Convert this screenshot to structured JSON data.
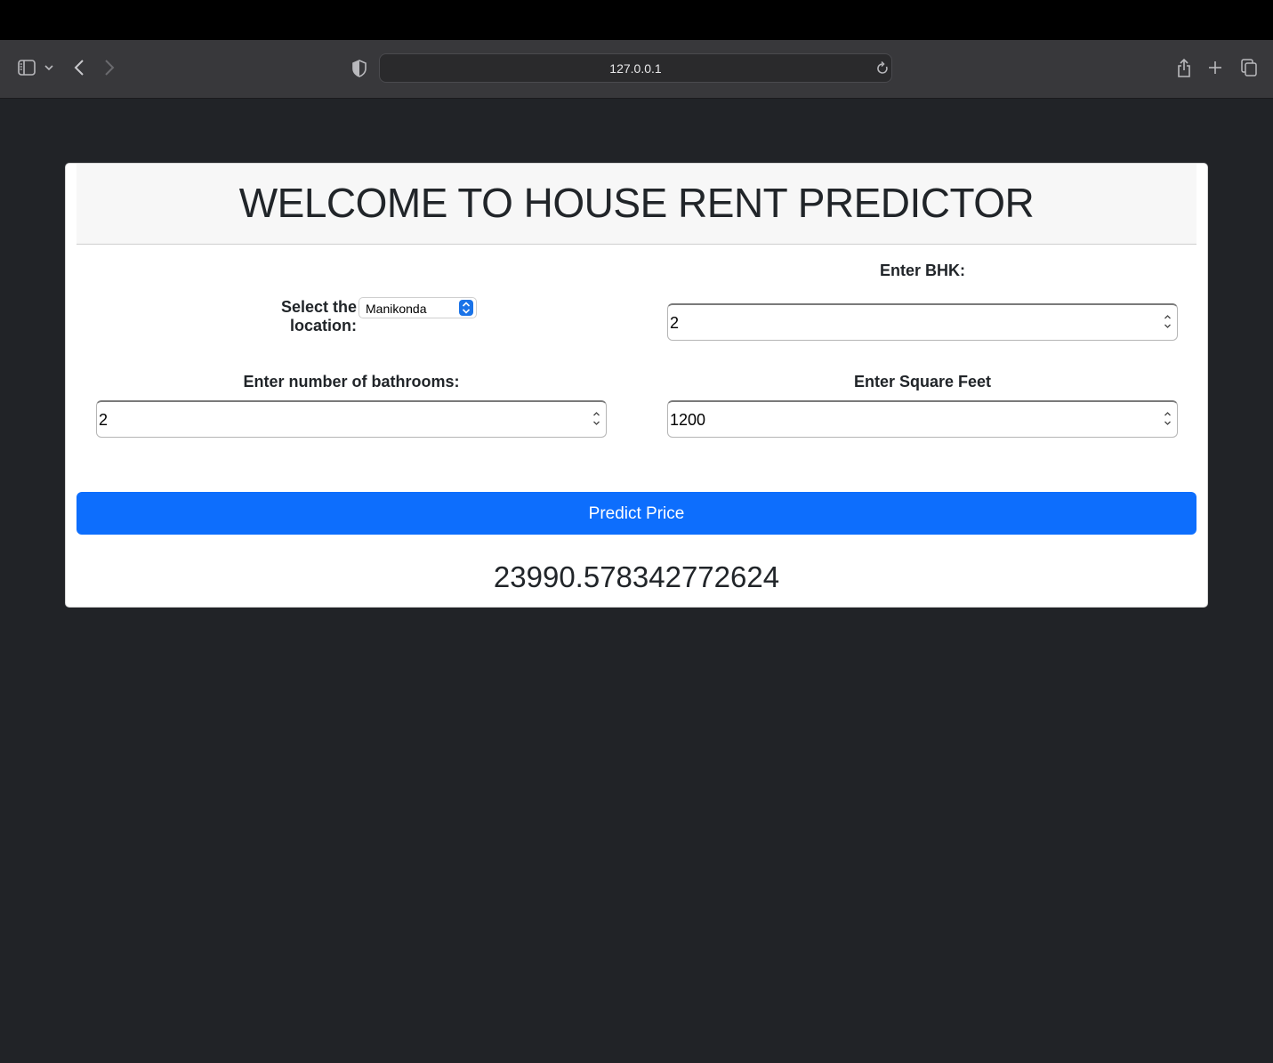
{
  "browser": {
    "address": "127.0.0.1"
  },
  "app": {
    "title": "WELCOME TO HOUSE RENT PREDICTOR",
    "location_label": "Select the location:",
    "location_value": "Manikonda",
    "bhk_label": "Enter BHK:",
    "bhk_value": "2",
    "bathrooms_label": "Enter number of bathrooms:",
    "bathrooms_value": "2",
    "sqft_label": "Enter Square Feet",
    "sqft_value": "1200",
    "predict_button": "Predict Price",
    "result": "23990.578342772624"
  },
  "colors": {
    "page_background": "#212327",
    "button": "#0d6efd",
    "header_background": "#f7f7f7"
  }
}
